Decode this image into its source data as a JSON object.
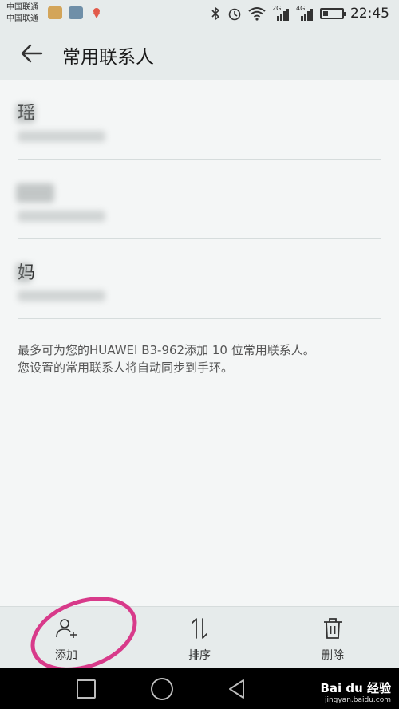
{
  "status_bar": {
    "carrier_1": "中国联通",
    "carrier_2": "中国联通",
    "net_2g": "2G",
    "net_4g": "4G",
    "time": "22:45",
    "icons": [
      "bluetooth-icon",
      "alarm-icon",
      "wifi-icon",
      "signal-icon",
      "battery-icon"
    ]
  },
  "header": {
    "title": "常用联系人"
  },
  "contacts": [
    {
      "name": "瑶"
    },
    {
      "name": ""
    },
    {
      "name": "妈"
    }
  ],
  "info": {
    "line1": "最多可为您的HUAWEI B3-962添加 10 位常用联系人。",
    "line2": "您设置的常用联系人将自动同步到手环。"
  },
  "toolbar": {
    "add_label": "添加",
    "sort_label": "排序",
    "delete_label": "删除"
  },
  "watermark": {
    "brand": "Bai du 经验",
    "url": "jingyan.baidu.com"
  },
  "colors": {
    "header_bg": "#e6ebeb",
    "page_bg": "#f4f6f6",
    "annotation": "#d83a8a"
  }
}
